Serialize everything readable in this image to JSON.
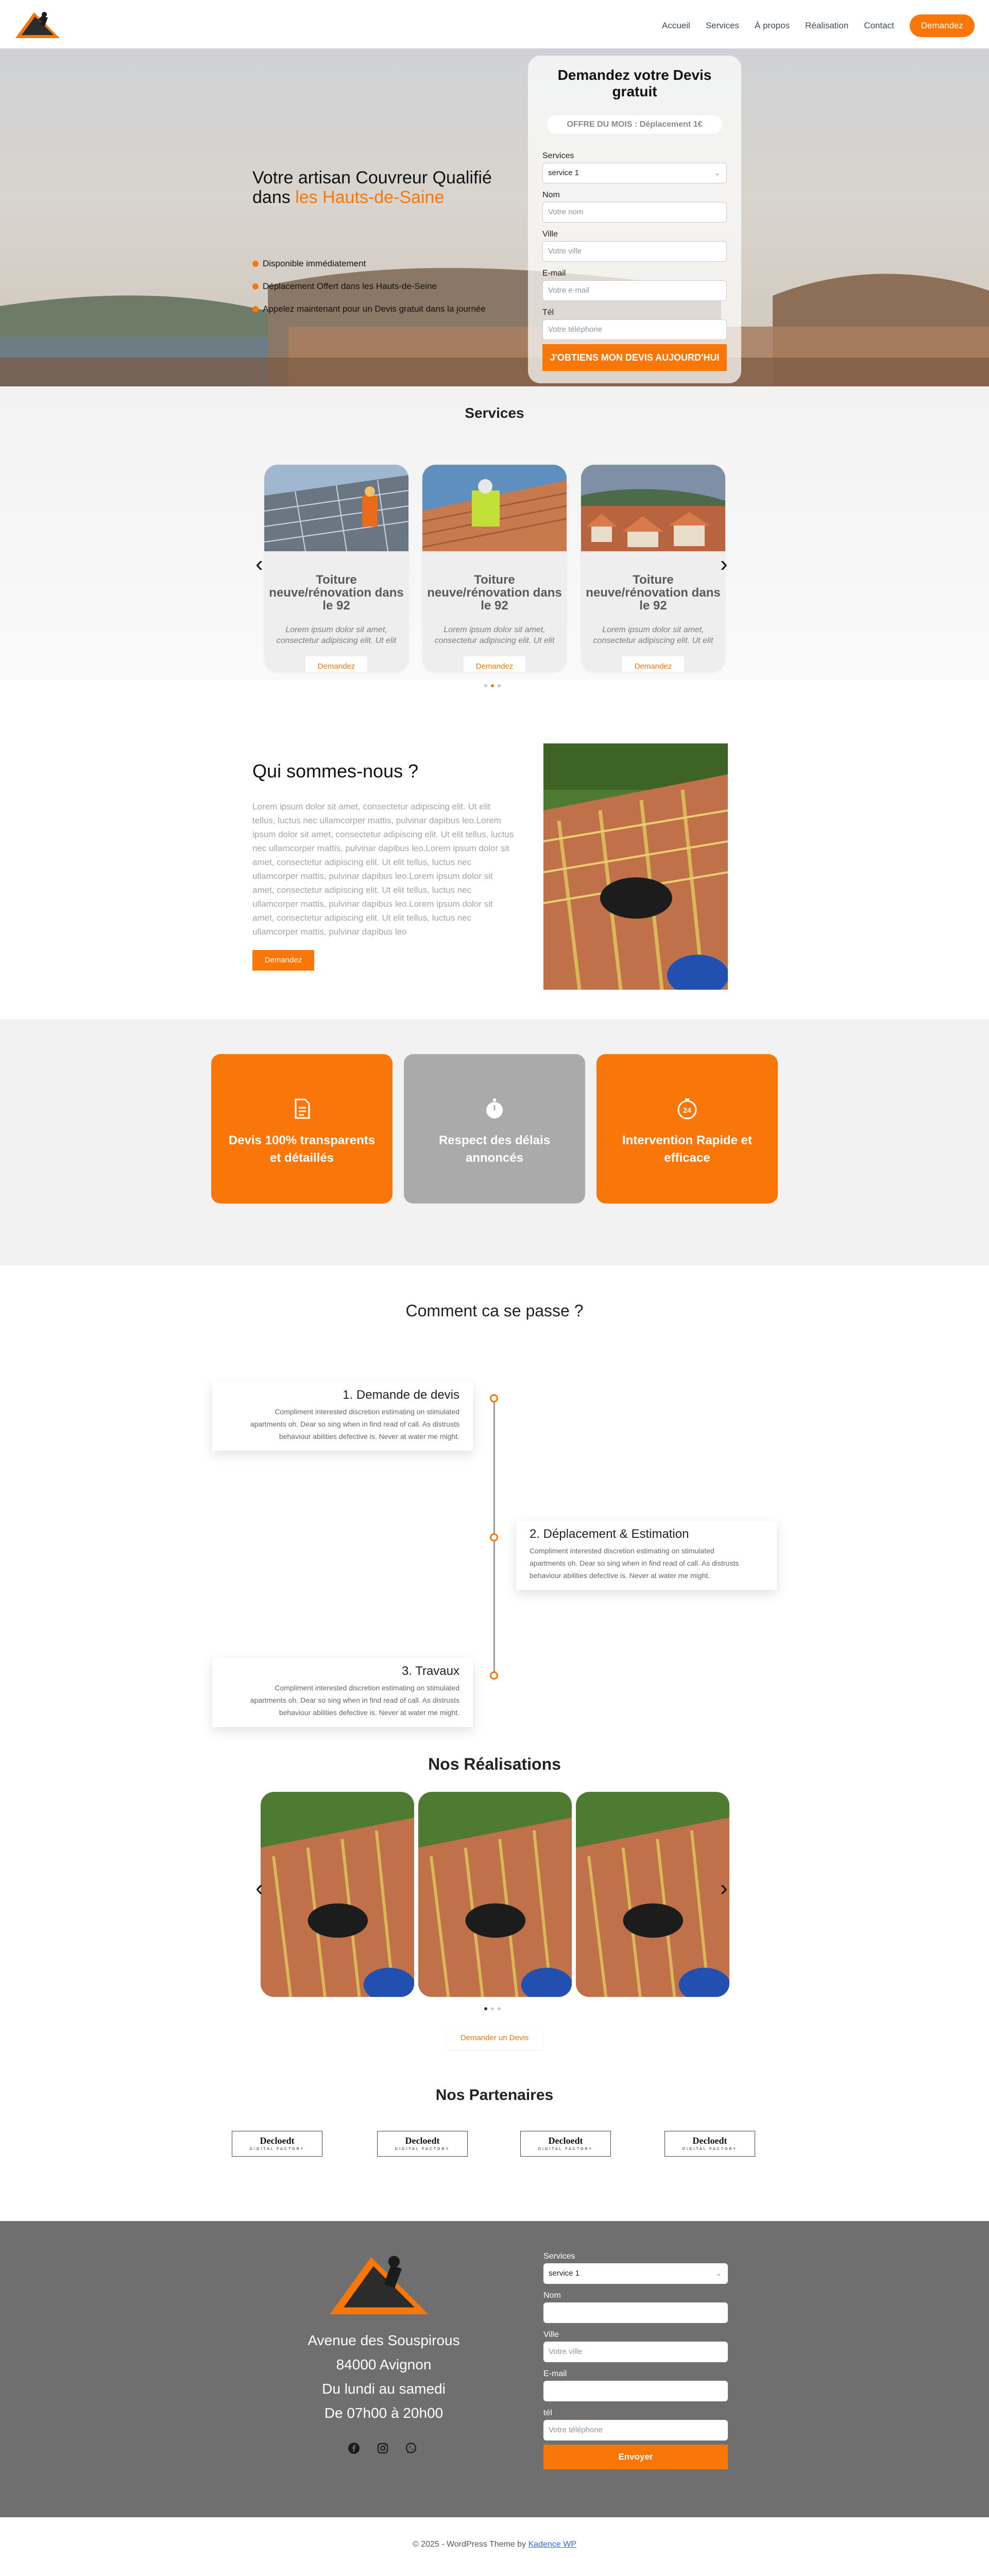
{
  "header": {
    "nav": [
      "Accueil",
      "Services",
      "À propos",
      "Réalisation",
      "Contact"
    ],
    "cta_label": "Demandez"
  },
  "hero": {
    "title_line1": "Votre artisan Couvreur Qualifié",
    "title_prefix": "dans ",
    "title_highlight": "les Hauts-de-Saine",
    "bullets": [
      "Disponible immédiatement",
      "Déplacement Offert dans les Hauts-de-Seine",
      "Appelez maintenant pour un Devis gratuit  dans la journée"
    ]
  },
  "quote_form": {
    "title": "Demandez votre Devis gratuit",
    "offer": "OFFRE DU MOIS : Déplacement 1€",
    "fields": [
      {
        "label": "Services",
        "value": "service 1"
      },
      {
        "label": "Nom",
        "placeholder": "Votre nom"
      },
      {
        "label": "Ville",
        "placeholder": "Votre ville"
      },
      {
        "label": "E-mail",
        "placeholder": "Votre e-mail"
      },
      {
        "label": "Tél",
        "placeholder": "Votre téléphone"
      }
    ],
    "submit_label": "J'OBTIENS MON DEVIS AUJOURD'HUI"
  },
  "services": {
    "title": "Services",
    "cards": [
      {
        "title": "Toiture neuve/rénovation dans le 92",
        "text": "Lorem ipsum dolor sit amet, consectetur adipiscing elit. Ut elit tellus, luctus nec ullamcorper mattis",
        "button": "Demandez"
      },
      {
        "title": "Toiture neuve/rénovation dans le 92",
        "text": "Lorem ipsum dolor sit amet, consectetur adipiscing elit. Ut elit tellus, luctus nec ullamcorper mattis",
        "button": "Demandez"
      },
      {
        "title": "Toiture neuve/rénovation dans le 92",
        "text": "Lorem ipsum dolor sit amet, consectetur adipiscing elit. Ut elit tellus, luctus nec ullamcorper mattis",
        "button": "Demandez"
      }
    ],
    "prev_icon": "chevron-left-icon",
    "next_icon": "chevron-right-icon",
    "active_slide": 1
  },
  "about": {
    "title": "Qui sommes-nous ?",
    "text": "Lorem ipsum dolor sit amet, consectetur adipiscing elit. Ut elit tellus, luctus nec ullamcorper mattis, pulvinar dapibus leo.Lorem ipsum dolor sit amet, consectetur adipiscing elit. Ut elit tellus, luctus nec ullamcorper mattis, pulvinar dapibus leo.Lorem ipsum dolor sit amet, consectetur adipiscing elit. Ut elit tellus, luctus nec ullamcorper mattis, pulvinar dapibus leo.Lorem ipsum dolor sit amet, consectetur adipiscing elit. Ut elit tellus, luctus nec ullamcorper mattis, pulvinar dapibus leo.Lorem ipsum dolor sit amet, consectetur adipiscing elit. Ut elit tellus, luctus nec ullamcorper mattis, pulvinar dapibus leo",
    "button": "Demandez"
  },
  "features": [
    {
      "icon": "document-icon",
      "title": "Devis 100% transparents et détaillés",
      "color": "#f97608"
    },
    {
      "icon": "stopwatch-icon",
      "title": "Respect des délais annoncés",
      "color": "#aaaaaa"
    },
    {
      "icon": "24h-icon",
      "title": "Intervention Rapide et efficace",
      "color": "#f97608"
    }
  ],
  "process": {
    "title": "Comment ca se passe ?",
    "steps": [
      {
        "title": "1. Demande de devis",
        "text": "Compliment interested discretion estimating on stimulated apartments oh. Dear so sing when in find read of call. As distrusts behaviour abilities defective is. Never at water me might."
      },
      {
        "title": "2. Déplacement & Estimation",
        "text": "Compliment interested discretion estimating on stimulated apartments oh. Dear so sing when in find read of call. As distrusts behaviour abilities defective is. Never at water me might."
      },
      {
        "title": "3. Travaux",
        "text": "Compliment interested discretion estimating on stimulated apartments oh. Dear so sing when in find read of call. As distrusts behaviour abilities defective is. Never at water me might."
      }
    ]
  },
  "realisations": {
    "title": "Nos Réalisations",
    "button": "Demander un Devis",
    "active_slide": 0
  },
  "partners": {
    "title": "Nos Partenaires",
    "items": [
      {
        "name": "Decloedt",
        "sub": "DIGITAL FACTORY"
      },
      {
        "name": "Decloedt",
        "sub": "DIGITAL FACTORY"
      },
      {
        "name": "Decloedt",
        "sub": "DIGITAL FACTORY"
      },
      {
        "name": "Decloedt",
        "sub": "DIGITAL FACTORY"
      }
    ]
  },
  "footer": {
    "address": [
      "Avenue des Souspirous",
      "84000 Avignon",
      "Du lundi au samedi",
      "De 07h00 à 20h00"
    ],
    "social_icons": [
      "facebook-icon",
      "instagram-icon",
      "whatsapp-icon"
    ],
    "form": {
      "fields": [
        {
          "label": "Services",
          "value": "service 1"
        },
        {
          "label": "Nom",
          "placeholder": ""
        },
        {
          "label": "Ville",
          "placeholder": "Votre ville"
        },
        {
          "label": "E-mail",
          "placeholder": ""
        },
        {
          "label": "tél",
          "placeholder": "Votre téléphone"
        }
      ],
      "submit_label": "Envoyer"
    }
  },
  "copyright": {
    "text": "© 2025 - WordPress Theme by ",
    "link": "Kadence WP"
  },
  "colors": {
    "accent": "#f97608",
    "footer_bg": "#6f6f6f",
    "grey_card": "#aaaaaa"
  }
}
